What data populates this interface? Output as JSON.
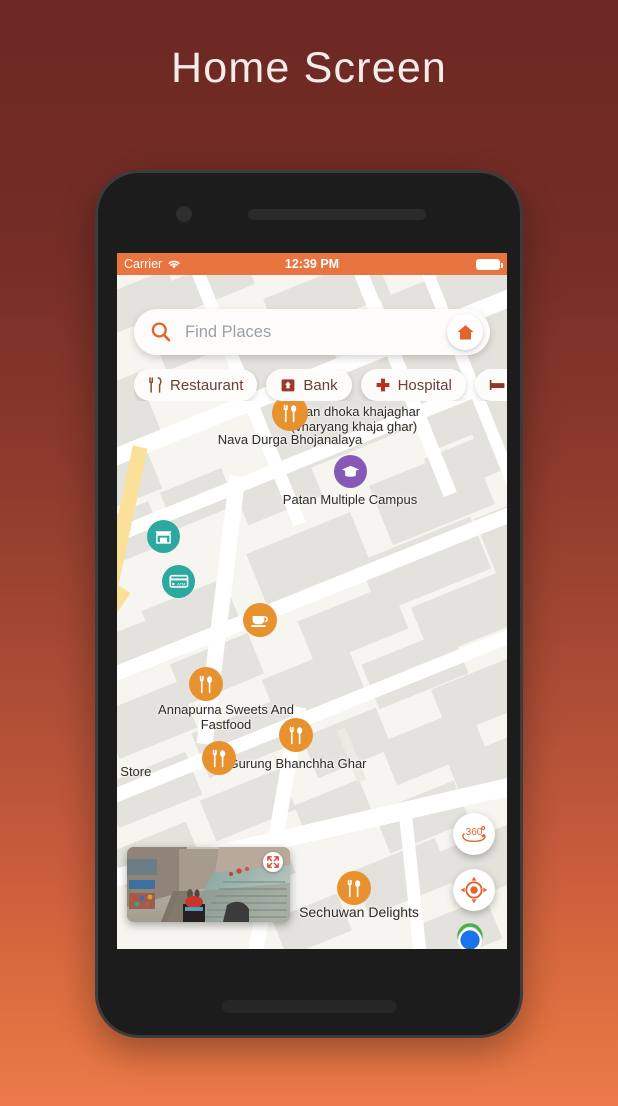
{
  "page": {
    "title": "Home Screen"
  },
  "statusbar": {
    "carrier": "Carrier",
    "wifi_icon": "wifi-icon",
    "time": "12:39 PM",
    "battery_icon": "battery-icon"
  },
  "search": {
    "placeholder": "Find Places",
    "search_icon": "search-icon",
    "home_icon": "home-icon"
  },
  "chips": [
    {
      "label": "Restaurant",
      "icon": "fork-knife-icon"
    },
    {
      "label": "Bank",
      "icon": "bank-building-icon"
    },
    {
      "label": "Hospital",
      "icon": "cross-icon"
    },
    {
      "label": "",
      "icon": "bed-icon"
    }
  ],
  "map": {
    "background_color": "#f7f5ef",
    "building_color": "#e4e2dc",
    "road_color": "#ffffff",
    "highway_color": "#fbe09a",
    "labels": [
      {
        "text": "patan dhoka khajaghar (vharyang khaja ghar)"
      },
      {
        "text": "Nava Durga Bhojanalaya"
      },
      {
        "text": "Patan Multiple Campus"
      },
      {
        "text": "Annapurna Sweets And Fastfood"
      },
      {
        "text": "Gurung Bhanchha Ghar"
      },
      {
        "text": "hara Store"
      },
      {
        "text": "Sechuwan Delights"
      }
    ],
    "pins": [
      {
        "name": "nava-durga-bhojanalaya",
        "type": "restaurant",
        "color": "#e8912f"
      },
      {
        "name": "patan-multiple-campus",
        "type": "education",
        "color": "#8758b5"
      },
      {
        "name": "store",
        "type": "shop",
        "color": "#2ba8a0"
      },
      {
        "name": "atm",
        "type": "atm",
        "color": "#2ba8a0"
      },
      {
        "name": "cafe",
        "type": "cafe",
        "color": "#e8912f"
      },
      {
        "name": "annapurna-sweets",
        "type": "restaurant",
        "color": "#e8912f"
      },
      {
        "name": "unnamed-restaurant",
        "type": "restaurant",
        "color": "#e8912f"
      },
      {
        "name": "gurung-bhanchha-ghar",
        "type": "restaurant",
        "color": "#e8912f"
      },
      {
        "name": "sechuwan-delights",
        "type": "restaurant",
        "color": "#e8912f"
      }
    ]
  },
  "controls": {
    "streetview_expand_icon": "expand-arrows-icon",
    "button_360_label": "360",
    "locate_icon": "locate-crosshair-icon",
    "user_location_icon": "user-location-dot"
  },
  "colors": {
    "accent_orange": "#e8743f",
    "pin_orange": "#e8912f",
    "pin_teal": "#2ba8a0",
    "pin_purple": "#8758b5",
    "bg_top": "#6d2823",
    "bg_bottom": "#ec7a4a"
  }
}
